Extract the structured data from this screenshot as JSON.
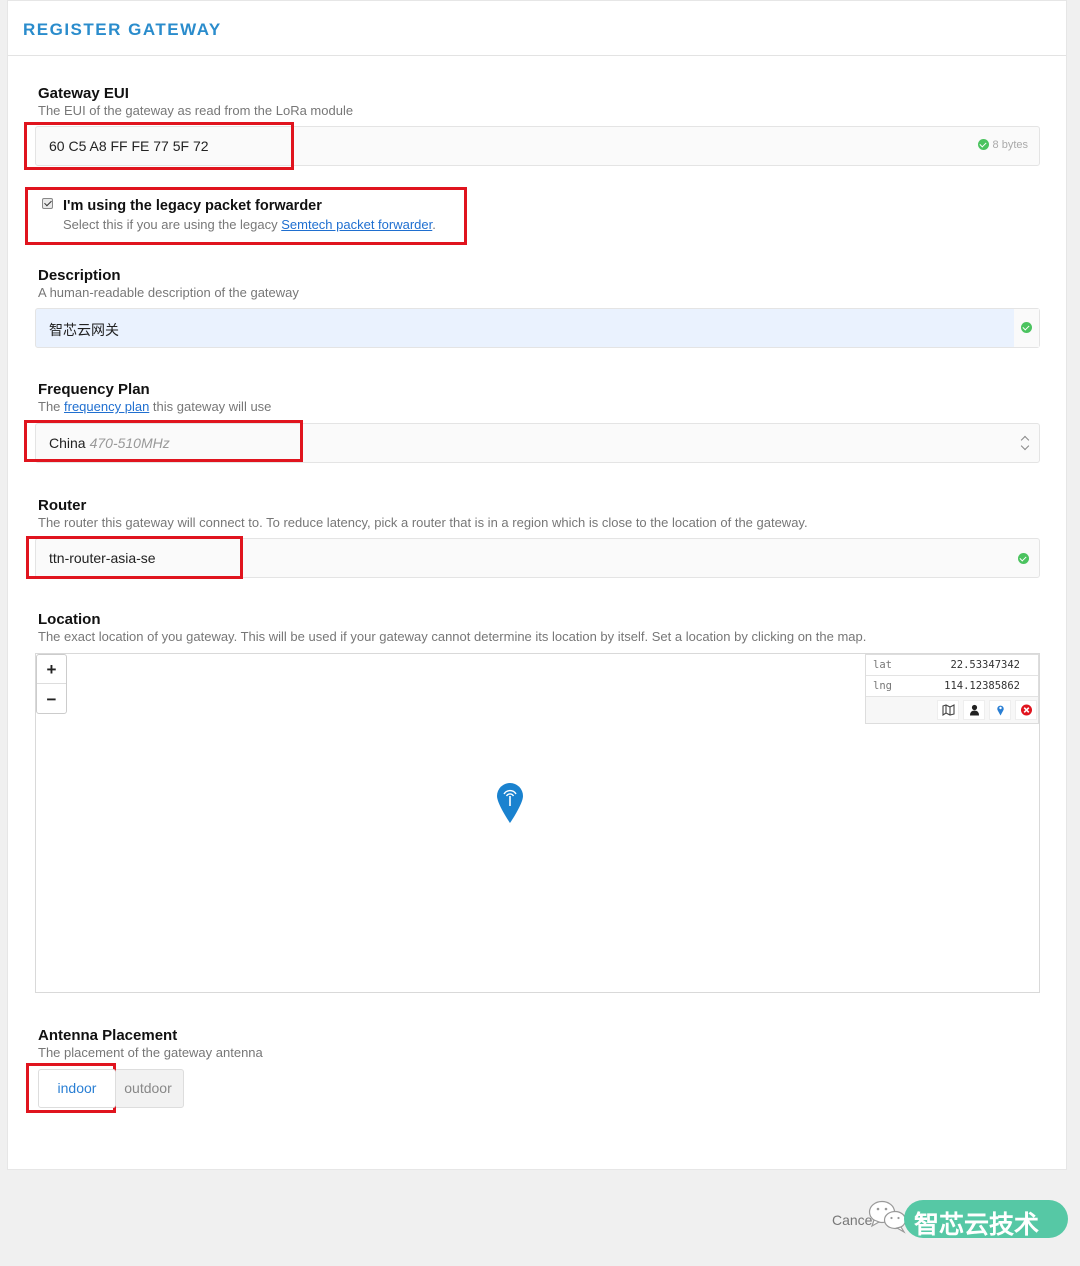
{
  "header": {
    "title": "REGISTER GATEWAY"
  },
  "gateway_eui": {
    "label": "Gateway EUI",
    "description": "The EUI of the gateway as read from the LoRa module",
    "value": "60  C5  A8  FF  FE  77  5F  72",
    "byte_count": "8 bytes"
  },
  "legacy_forwarder": {
    "checked": true,
    "label": "I'm using the legacy packet forwarder",
    "description_prefix": "Select this if you are using the legacy ",
    "link": "Semtech packet forwarder",
    "description_suffix": "."
  },
  "description_field": {
    "label": "Description",
    "description": "A human-readable description of the gateway",
    "value": "智芯云网关"
  },
  "frequency_plan": {
    "label": "Frequency Plan",
    "description_prefix": "The ",
    "link": "frequency plan",
    "description_suffix": " this gateway will use",
    "selected": "China",
    "selected_hint": "470-510MHz"
  },
  "router": {
    "label": "Router",
    "description": "The router this gateway will connect to. To reduce latency, pick a router that is in a region which is close to the location of the gateway.",
    "value": "ttn-router-asia-se"
  },
  "location": {
    "label": "Location",
    "description": "The exact location of you gateway. This will be used if your gateway cannot determine its location by itself. Set a location by clicking on the map.",
    "zoom_in": "+",
    "zoom_out": "−",
    "lat_key": "lat",
    "lat": "22.53347342",
    "lng_key": "lng",
    "lng": "114.12385862",
    "tool_icons": [
      "map-icon",
      "user-icon",
      "pin-icon",
      "clear-icon"
    ]
  },
  "antenna": {
    "label": "Antenna Placement",
    "description": "The placement of the gateway antenna",
    "options": [
      "indoor",
      "outdoor"
    ],
    "selected": "indoor"
  },
  "footer": {
    "cancel": "Cance"
  },
  "watermark": {
    "text": "智芯云技术"
  },
  "colors": {
    "accent": "#2a8ccc",
    "valid": "#4bc35f",
    "annotation": "#e0141e",
    "watermark": "#56c8a5"
  }
}
